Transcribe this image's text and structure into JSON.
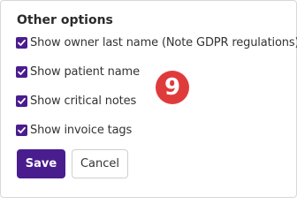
{
  "colors": {
    "accent": "#4a1d8f",
    "badge": "#e03b3b"
  },
  "section": {
    "title": "Other options"
  },
  "options": [
    {
      "label": "Show owner last name (Note GDPR regulations)",
      "checked": true,
      "icon": "check-icon"
    },
    {
      "label": "Show patient name",
      "checked": true,
      "icon": "check-icon"
    },
    {
      "label": "Show critical notes",
      "checked": true,
      "icon": "check-icon"
    },
    {
      "label": "Show invoice tags",
      "checked": true,
      "icon": "check-icon"
    }
  ],
  "badge": {
    "text": "9"
  },
  "buttons": {
    "save_label": "Save",
    "cancel_label": "Cancel"
  }
}
